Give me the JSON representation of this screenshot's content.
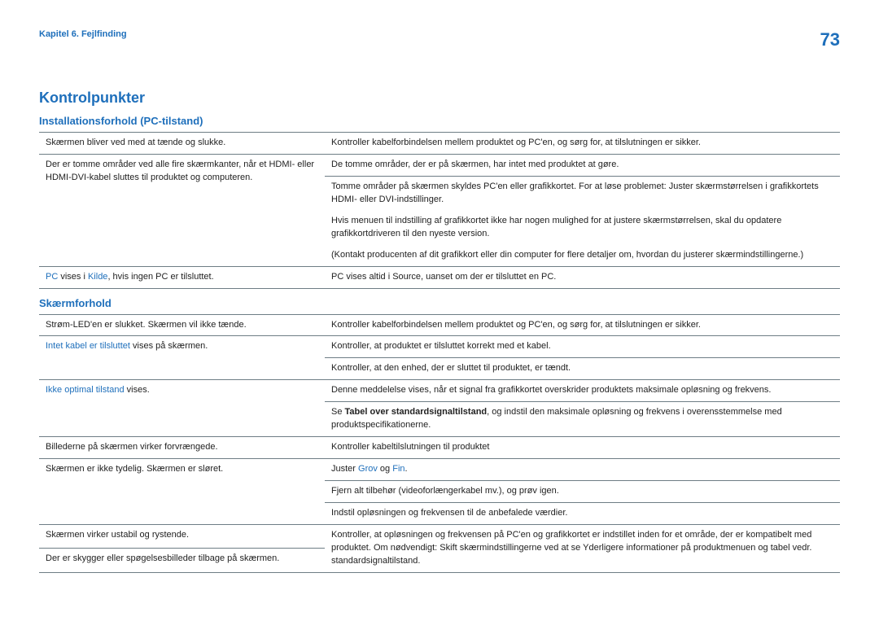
{
  "header": {
    "chapter": "Kapitel 6. Fejlfinding",
    "page_number": "73"
  },
  "title": "Kontrolpunkter",
  "sec1": {
    "heading": "Installationsforhold (PC-tilstand)",
    "r1c1": "Skærmen bliver ved med at tænde og slukke.",
    "r1c2": "Kontroller kabelforbindelsen mellem produktet og PC'en, og sørg for, at tilslutningen er sikker.",
    "r2c1": "Der er tomme områder ved alle fire skærmkanter, når et HDMI- eller HDMI-DVI-kabel sluttes til produktet og computeren.",
    "r2c2a": "De tomme områder, der er på skærmen, har intet med produktet at gøre.",
    "r2c2b": "Tomme områder på skærmen skyldes PC'en eller grafikkortet. For at løse problemet: Juster skærmstørrelsen i grafikkortets HDMI- eller DVI-indstillinger.",
    "r2c2c": "Hvis menuen til indstilling af grafikkortet ikke har nogen mulighed for at justere skærmstørrelsen, skal du opdatere grafikkortdriveren til den nyeste version.",
    "r2c2d": "(Kontakt producenten af dit grafikkort eller din computer for flere detaljer om, hvordan du justerer skærmindstillingerne.)",
    "r3c1_pc": "PC",
    "r3c1_mid": " vises i ",
    "r3c1_kilde": "Kilde",
    "r3c1_end": ", hvis ingen PC er tilsluttet.",
    "r3c2": "PC vises altid i Source, uanset om der er tilsluttet en PC."
  },
  "sec2": {
    "heading": "Skærmforhold",
    "r1c1": "Strøm-LED'en er slukket. Skærmen vil ikke tænde.",
    "r1c2": "Kontroller kabelforbindelsen mellem produktet og PC'en, og sørg for, at tilslutningen er sikker.",
    "r2c1_a": "Intet kabel er tilsluttet",
    "r2c1_b": " vises på skærmen.",
    "r2c2a": "Kontroller, at produktet er tilsluttet korrekt med et kabel.",
    "r2c2b": "Kontroller, at den enhed, der er sluttet til produktet, er tændt.",
    "r3c1_a": "Ikke optimal tilstand",
    "r3c1_b": " vises.",
    "r3c2a": "Denne meddelelse vises, når et signal fra grafikkortet overskrider produktets maksimale opløsning og frekvens.",
    "r3c2b_pre": "Se ",
    "r3c2b_bold": "Tabel over standardsignaltilstand",
    "r3c2b_post": ", og indstil den maksimale opløsning og frekvens i overensstemmelse med produktspecifikationerne.",
    "r4c1": "Billederne på skærmen virker forvrængede.",
    "r4c2": "Kontroller kabeltilslutningen til produktet",
    "r5c1": "Skærmen er ikke tydelig. Skærmen er sløret.",
    "r5c2a_pre": "Juster ",
    "r5c2a_grov": "Grov",
    "r5c2a_og": " og ",
    "r5c2a_fin": "Fin",
    "r5c2a_end": ".",
    "r5c2b": "Fjern alt tilbehør (videoforlængerkabel mv.), og prøv igen.",
    "r5c2c": "Indstil opløsningen og frekvensen til de anbefalede værdier.",
    "r6c1a": "Skærmen virker ustabil og rystende.",
    "r6c1b": "Der er skygger eller spøgelsesbilleder tilbage på skærmen.",
    "r6c2": "Kontroller, at opløsningen og frekvensen på PC'en og grafikkortet er indstillet inden for et område, der er kompatibelt med produktet. Om nødvendigt: Skift skærmindstillingerne ved at se Yderligere informationer på produktmenuen og tabel vedr. standardsignaltilstand."
  }
}
